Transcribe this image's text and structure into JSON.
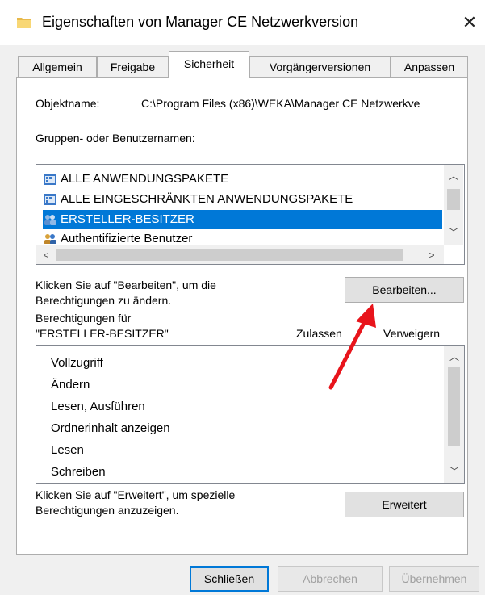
{
  "window": {
    "title": "Eigenschaften von Manager CE Netzwerkversion",
    "close_symbol": "✕",
    "icon": "folder-icon"
  },
  "tabs": [
    {
      "label": "Allgemein",
      "active": false
    },
    {
      "label": "Freigabe",
      "active": false
    },
    {
      "label": "Sicherheit",
      "active": true
    },
    {
      "label": "Vorgängerversionen",
      "active": false
    },
    {
      "label": "Anpassen",
      "active": false
    }
  ],
  "security": {
    "object_label": "Objektname:",
    "object_value": "C:\\Program Files (x86)\\WEKA\\Manager CE Netzwerkve",
    "groups_label": "Gruppen- oder Benutzernamen:",
    "groups": [
      {
        "name": "ALLE ANWENDUNGSPAKETE",
        "icon": "app-package-icon",
        "selected": false
      },
      {
        "name": "ALLE EINGESCHRÄNKTEN ANWENDUNGSPAKETE",
        "icon": "app-package-icon",
        "selected": false
      },
      {
        "name": "ERSTELLER-BESITZER",
        "icon": "users-icon",
        "selected": true
      },
      {
        "name": "Authentifizierte Benutzer",
        "icon": "users-icon",
        "selected": false
      }
    ],
    "edit_hint_line1": "Klicken Sie auf \"Bearbeiten\", um die",
    "edit_hint_line2": "Berechtigungen zu ändern.",
    "edit_button": "Bearbeiten...",
    "perm_for_line1": "Berechtigungen für",
    "perm_for_line2": "\"ERSTELLER-BESITZER\"",
    "allow_header": "Zulassen",
    "deny_header": "Verweigern",
    "permissions": [
      "Vollzugriff",
      "Ändern",
      "Lesen, Ausführen",
      "Ordnerinhalt anzeigen",
      "Lesen",
      "Schreiben"
    ],
    "advanced_hint_line1": "Klicken Sie auf \"Erweitert\", um spezielle",
    "advanced_hint_line2": "Berechtigungen anzuzeigen.",
    "advanced_button": "Erweitert"
  },
  "footer": {
    "close_button": "Schließen",
    "cancel_button": "Abbrechen",
    "apply_button": "Übernehmen"
  },
  "annotation": {
    "type": "red-arrow",
    "color": "#e8141b"
  }
}
